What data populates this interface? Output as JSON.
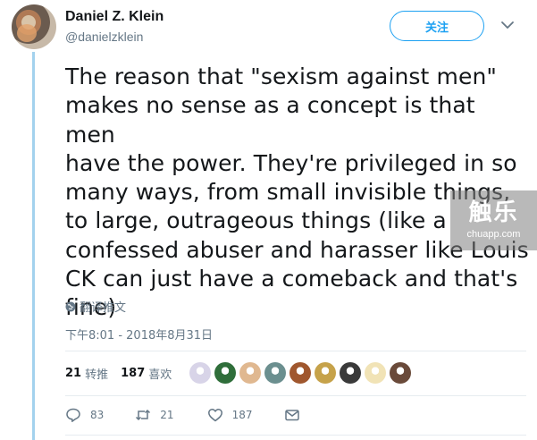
{
  "author": {
    "name": "Daniel Z. Klein",
    "handle": "@danielzklein"
  },
  "follow_button": {
    "label": "关注"
  },
  "tweet": {
    "text": "The reason that \"sexism against men\"\nmakes no sense as a concept is that men\nhave the power. They're privileged in so\nmany ways, from small invisible things,\nto large, outrageous things (like a\nconfessed abuser and harasser like Louis\nCK can just have a comeback and that's\nfine)",
    "translate_label": "翻译推文",
    "timestamp": "下午8:01 - 2018年8月31日"
  },
  "watermark": {
    "logo": "触乐",
    "url": "chuapp.com"
  },
  "stats": {
    "retweets": {
      "count": "21",
      "label": "转推"
    },
    "likes": {
      "count": "187",
      "label": "喜欢"
    }
  },
  "liker_avatars": [
    {
      "icon": "user-avatar",
      "color": "#d8d4e8"
    },
    {
      "icon": "user-avatar",
      "color": "#2f6e3a"
    },
    {
      "icon": "user-avatar",
      "color": "#e0b890"
    },
    {
      "icon": "user-avatar",
      "color": "#6b8f8f"
    },
    {
      "icon": "user-avatar",
      "color": "#a0572e"
    },
    {
      "icon": "user-avatar",
      "color": "#c6a24a"
    },
    {
      "icon": "user-avatar",
      "color": "#3a3a3a"
    },
    {
      "icon": "user-avatar",
      "color": "#f1e3b6"
    },
    {
      "icon": "user-avatar",
      "color": "#6a4a3a"
    }
  ],
  "actions": {
    "reply_count": "83",
    "retweet_count": "21",
    "like_count": "187"
  },
  "colors": {
    "accent": "#1da1f2",
    "thread_line": "#a3d2ee",
    "muted": "#657786",
    "text": "#14171a"
  }
}
